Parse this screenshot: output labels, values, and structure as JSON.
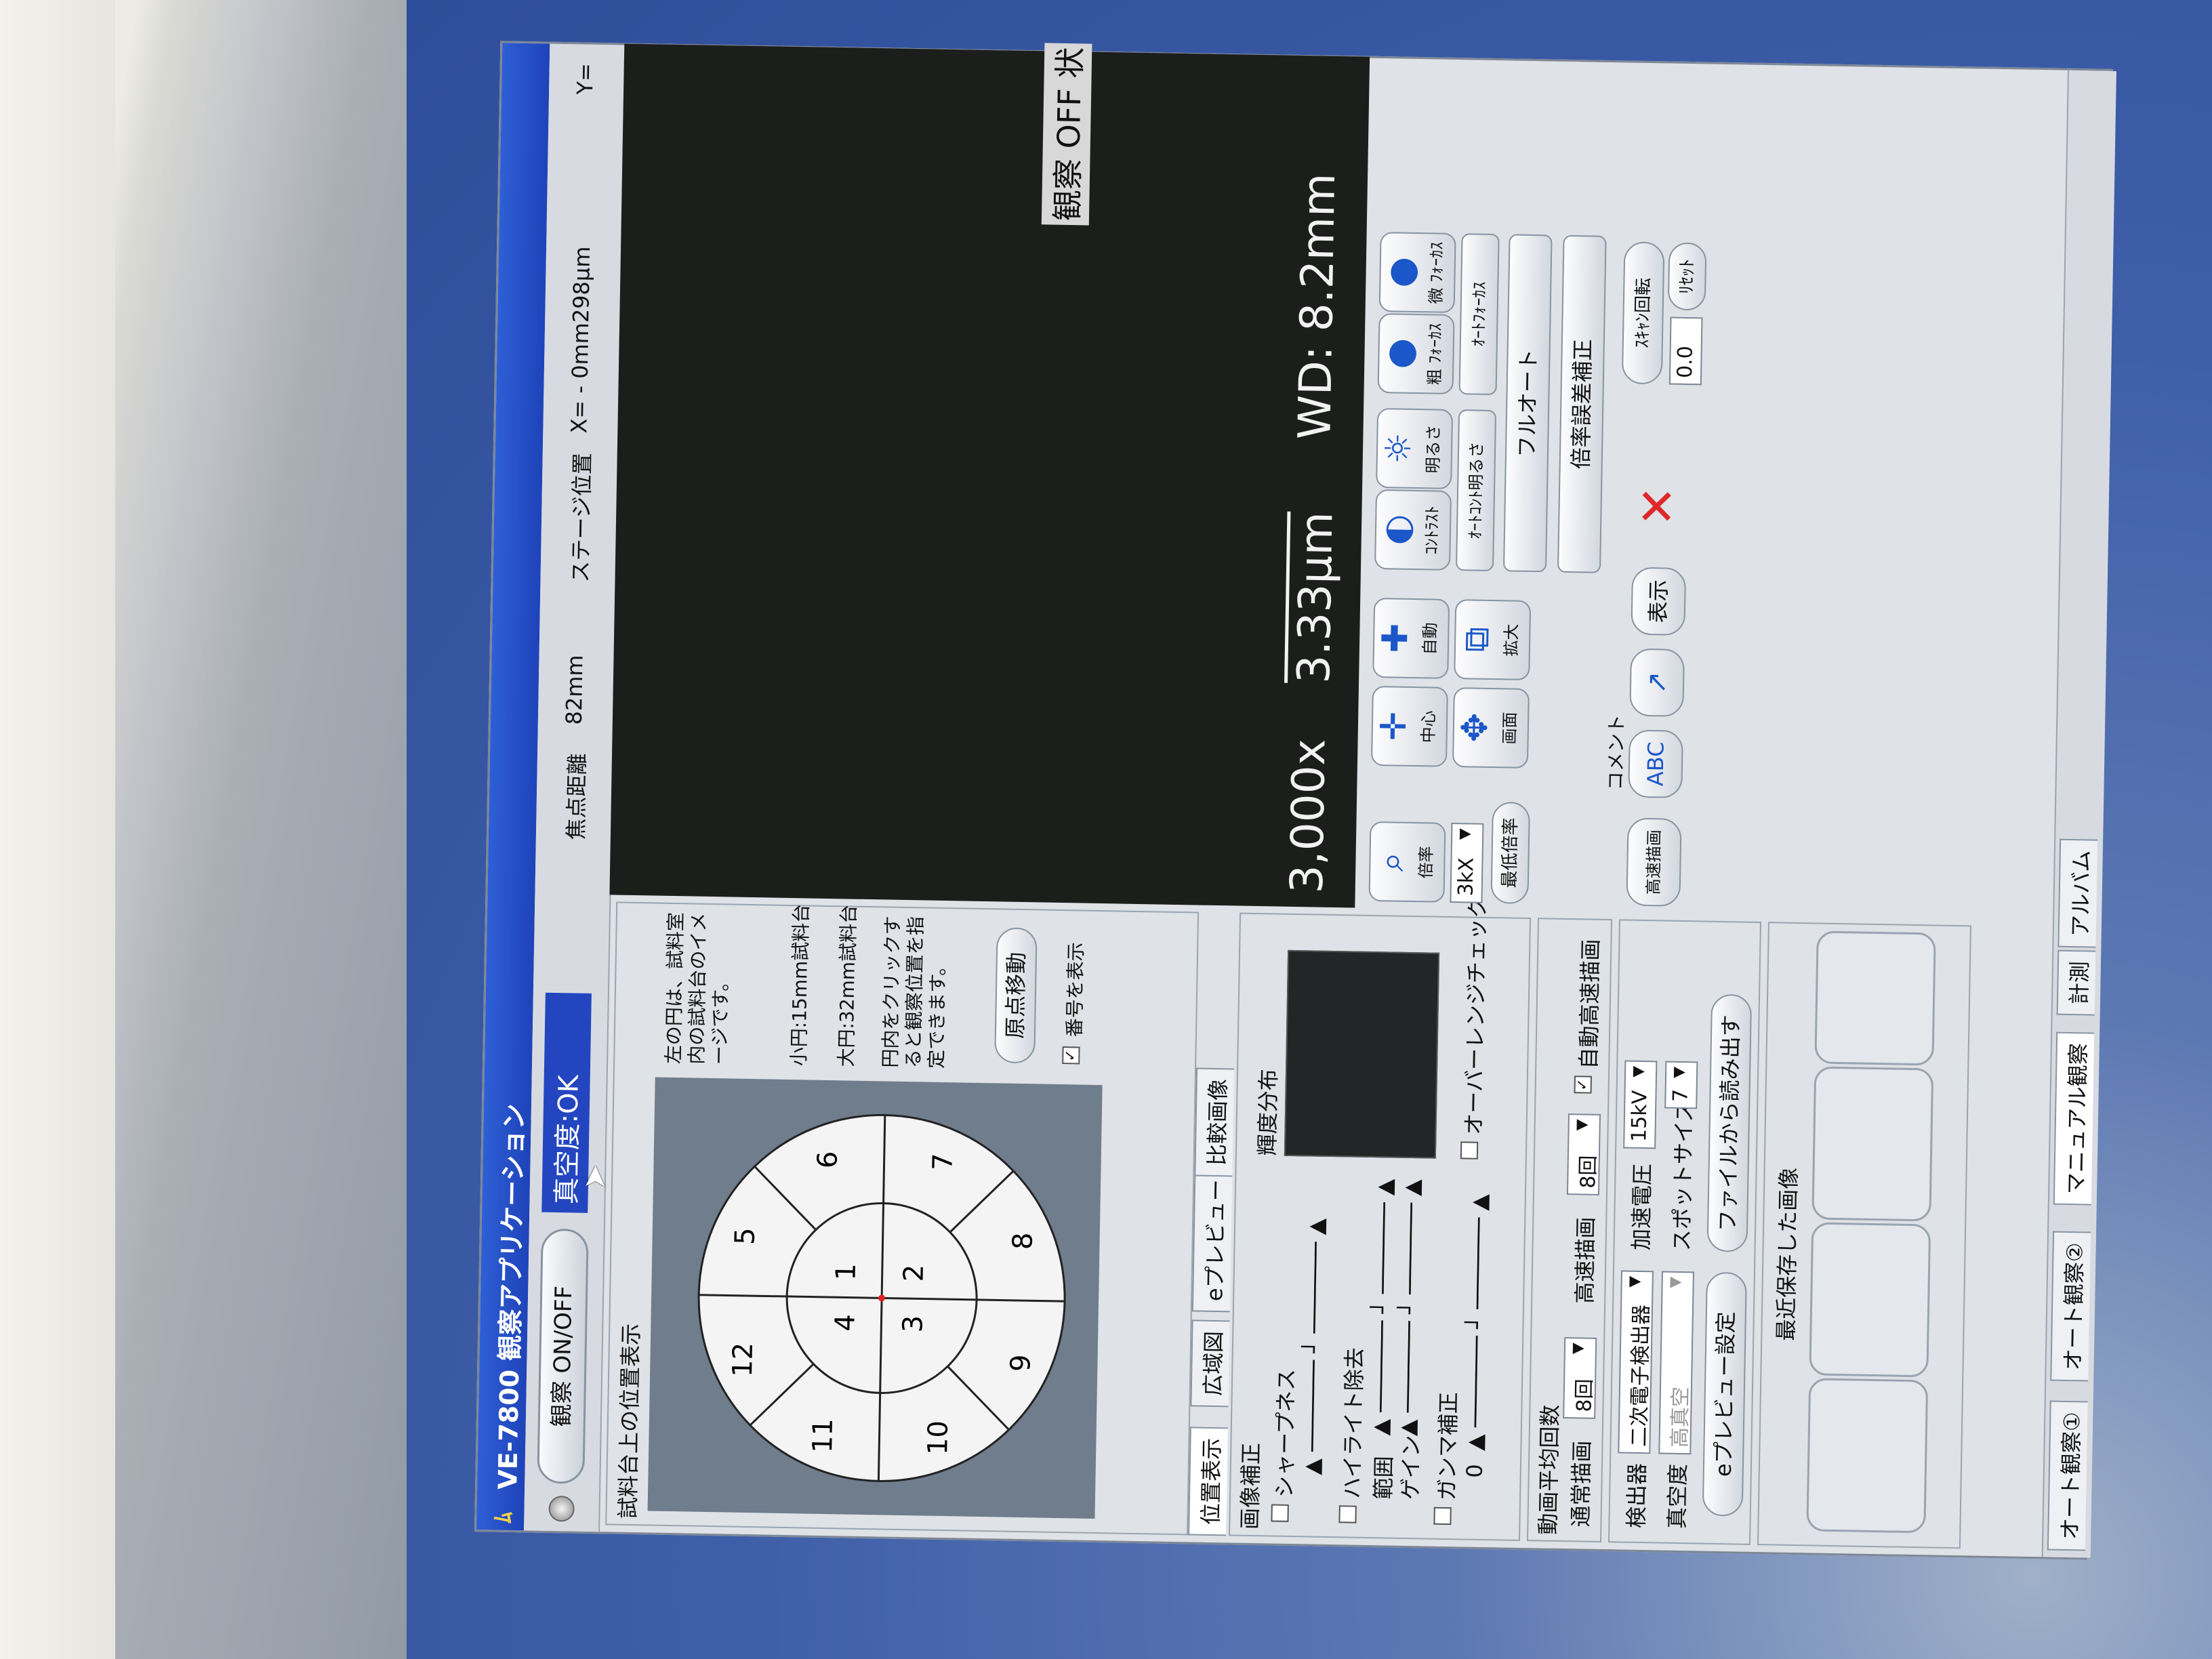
{
  "window": {
    "title": "VE-7800  観察アプリケーション"
  },
  "toolbar": {
    "observe_toggle": "観察 ON/OFF",
    "vacuum_status": "真空度:OK",
    "focus_distance_label": "焦点距離",
    "focus_distance_value": "82mm",
    "stage_position_label": "ステージ位置",
    "stage_x": "X=  -  0mm298μm",
    "stage_y_prefix": "Y="
  },
  "stage_panel": {
    "title": "試料台上の位置表示",
    "desc1": "左の円は、試料室内の試料台のイメージです。",
    "small_circle": "小円:15mm試料台",
    "large_circle": "大円:32mm試料台",
    "desc2": "円内をクリックすると観察位置を指定できます。",
    "origin_button": "原点移動",
    "show_numbers_label": "番号を表示",
    "show_numbers_checked": true,
    "inner_numbers": [
      "1",
      "2",
      "3",
      "4"
    ],
    "outer_numbers": [
      "5",
      "6",
      "7",
      "8",
      "9",
      "10",
      "11",
      "12"
    ]
  },
  "tabs": [
    "位置表示",
    "広域図",
    "eプレビュー",
    "比較画像"
  ],
  "image_correction": {
    "title": "画像補正",
    "sharpness": "シャープネス",
    "highlight_removal": "ハイライト除去",
    "range": "範囲",
    "gain": "ゲイン",
    "gamma": "ガンマ補正",
    "gamma_value": "0",
    "histogram_label": "輝度分布",
    "overrange_check": "オーバーレンジチェック"
  },
  "frame_average": {
    "title": "動画平均回数",
    "normal_label": "通常描画",
    "normal_value": "8回",
    "fast_label": "高速描画",
    "fast_value": "8回",
    "auto_fast": "自動高速描画",
    "auto_fast_checked": true
  },
  "settings": {
    "detector_label": "検出器",
    "detector_value": "二次電子検出器",
    "accel_label": "加速電圧",
    "accel_value": "15kV",
    "vacuum_label": "真空度",
    "vacuum_value": "高真空",
    "spot_label": "スポットサイズ",
    "spot_value": "7",
    "epreview_button": "eプレビュー設定",
    "load_file_button": "ファイルから読み出す"
  },
  "recent": {
    "title": "最近保存した画像"
  },
  "image_view": {
    "overlay_status": "観察 OFF 状",
    "magnification": "3,000x",
    "scale": "3.33μm",
    "wd": "WD: 8.2mm"
  },
  "controls": {
    "mag_button": "倍率",
    "mag_value": "3kX",
    "min_mag_button": "最低倍率",
    "center_button": "中心",
    "move_button": "画面",
    "auto_button": "自動",
    "zoom_button": "拡大",
    "contrast_button": "ｺﾝﾄﾗｽﾄ",
    "brightness_button": "明るさ",
    "coarse_focus": "粗 ﾌｫｰｶｽ",
    "fine_focus": "微 ﾌｫｰｶｽ",
    "auto_contrast_brightness": "ｵｰﾄｺﾝﾄ明るさ",
    "auto_focus": "ｵｰﾄﾌｫｰｶｽ",
    "full_auto": "フルオート",
    "mag_error_correct": "倍率誤差補正",
    "scan_rotation": "ｽｷｬﾝ回転",
    "rotation_value": "0.0",
    "reset": "ﾘｾｯﾄ",
    "fast_draw": "高速描画",
    "comment_label": "コメント",
    "text_tool": "ABC",
    "arrow_tool": "↗",
    "display_button": "表示",
    "close_icon": "✕"
  },
  "bottom_tabs": [
    "オート観察①",
    "オート観察②",
    "マニュアル観察",
    "計測",
    "アルバム"
  ]
}
